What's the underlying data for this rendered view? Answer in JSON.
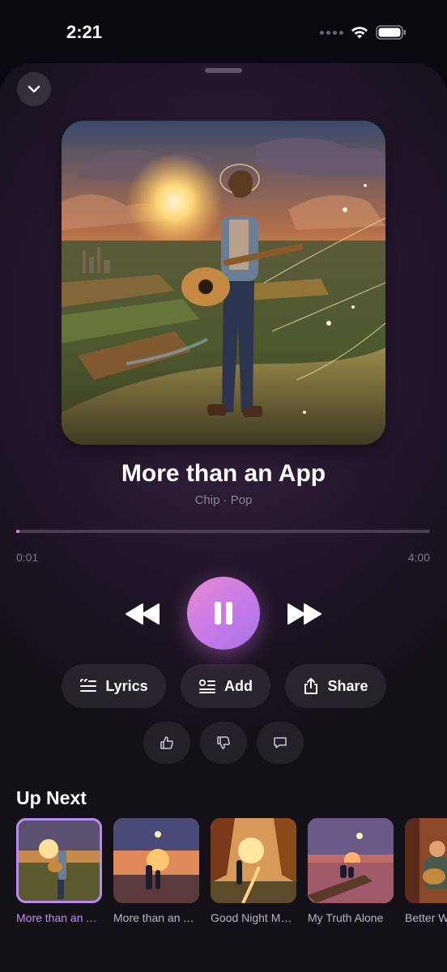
{
  "status": {
    "time": "2:21"
  },
  "player": {
    "title": "More than an App",
    "subtitle": "Chip · Pop",
    "elapsed": "0:01",
    "duration": "4:00",
    "progress_fraction": 0.004
  },
  "actions": {
    "lyrics": "Lyrics",
    "add": "Add",
    "share": "Share"
  },
  "up_next": {
    "title": "Up Next",
    "items": [
      {
        "label": "More than an App",
        "active": true
      },
      {
        "label": "More than an App",
        "active": false
      },
      {
        "label": "Good Night Moon",
        "active": false
      },
      {
        "label": "My Truth Alone",
        "active": false
      },
      {
        "label": "Better Ways",
        "active": false
      }
    ]
  },
  "colors": {
    "accent": "#c18df1",
    "play_gradient_start": "#e88ad4",
    "play_gradient_end": "#a873ea"
  }
}
